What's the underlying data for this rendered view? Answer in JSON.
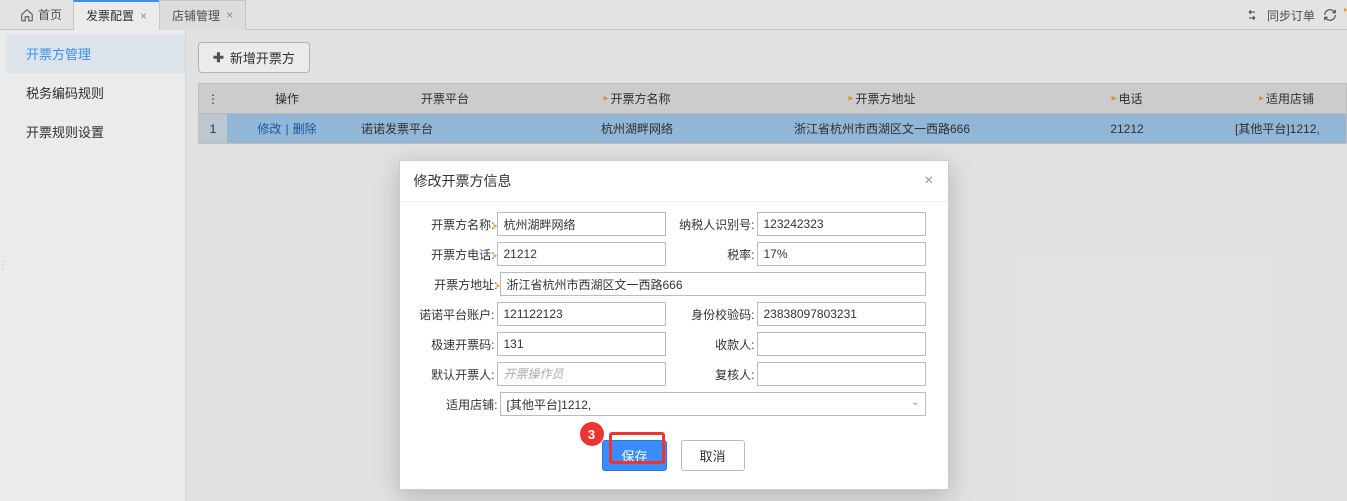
{
  "tabs": {
    "home": "首页",
    "items": [
      {
        "label": "发票配置",
        "active": true
      },
      {
        "label": "店铺管理",
        "active": false
      }
    ]
  },
  "topright": {
    "sync": "同步订单"
  },
  "sidebar": {
    "items": [
      {
        "label": "开票方管理",
        "active": true
      },
      {
        "label": "税务编码规则",
        "active": false
      },
      {
        "label": "开票规则设置",
        "active": false
      }
    ]
  },
  "toolbar": {
    "add_label": "新增开票方"
  },
  "table": {
    "headers": {
      "op": "操作",
      "platform": "开票平台",
      "name": "开票方名称",
      "addr": "开票方地址",
      "phone": "电话",
      "shop": "适用店铺"
    },
    "row": {
      "idx": "1",
      "edit": "修改",
      "del": "删除",
      "platform": "诺诺发票平台",
      "name": "杭州湖畔网络",
      "addr": "浙江省杭州市西湖区文一西路666",
      "phone": "21212",
      "shop": "[其他平台]1212,"
    }
  },
  "dialog": {
    "title": "修改开票方信息",
    "labels": {
      "name": "开票方名称:",
      "taxno": "纳税人识别号:",
      "phone": "开票方电话:",
      "rate": "税率:",
      "addr": "开票方地址:",
      "account": "诺诺平台账户:",
      "idcheck": "身份校验码:",
      "fastcode": "极速开票码:",
      "payee": "收款人:",
      "drawer": "默认开票人:",
      "reviewer": "复核人:",
      "shop": "适用店铺:"
    },
    "values": {
      "name": "杭州湖畔网络",
      "taxno": "123242323",
      "phone": "21212",
      "rate": "17%",
      "addr": "浙江省杭州市西湖区文一西路666",
      "account": "121122123",
      "idcheck": "23838097803231",
      "fastcode": "131",
      "payee": "",
      "drawer": "",
      "reviewer": "",
      "shop": "[其他平台]1212,"
    },
    "placeholders": {
      "drawer": "开票操作员"
    },
    "buttons": {
      "save": "保存",
      "cancel": "取消"
    },
    "callout": "3"
  }
}
